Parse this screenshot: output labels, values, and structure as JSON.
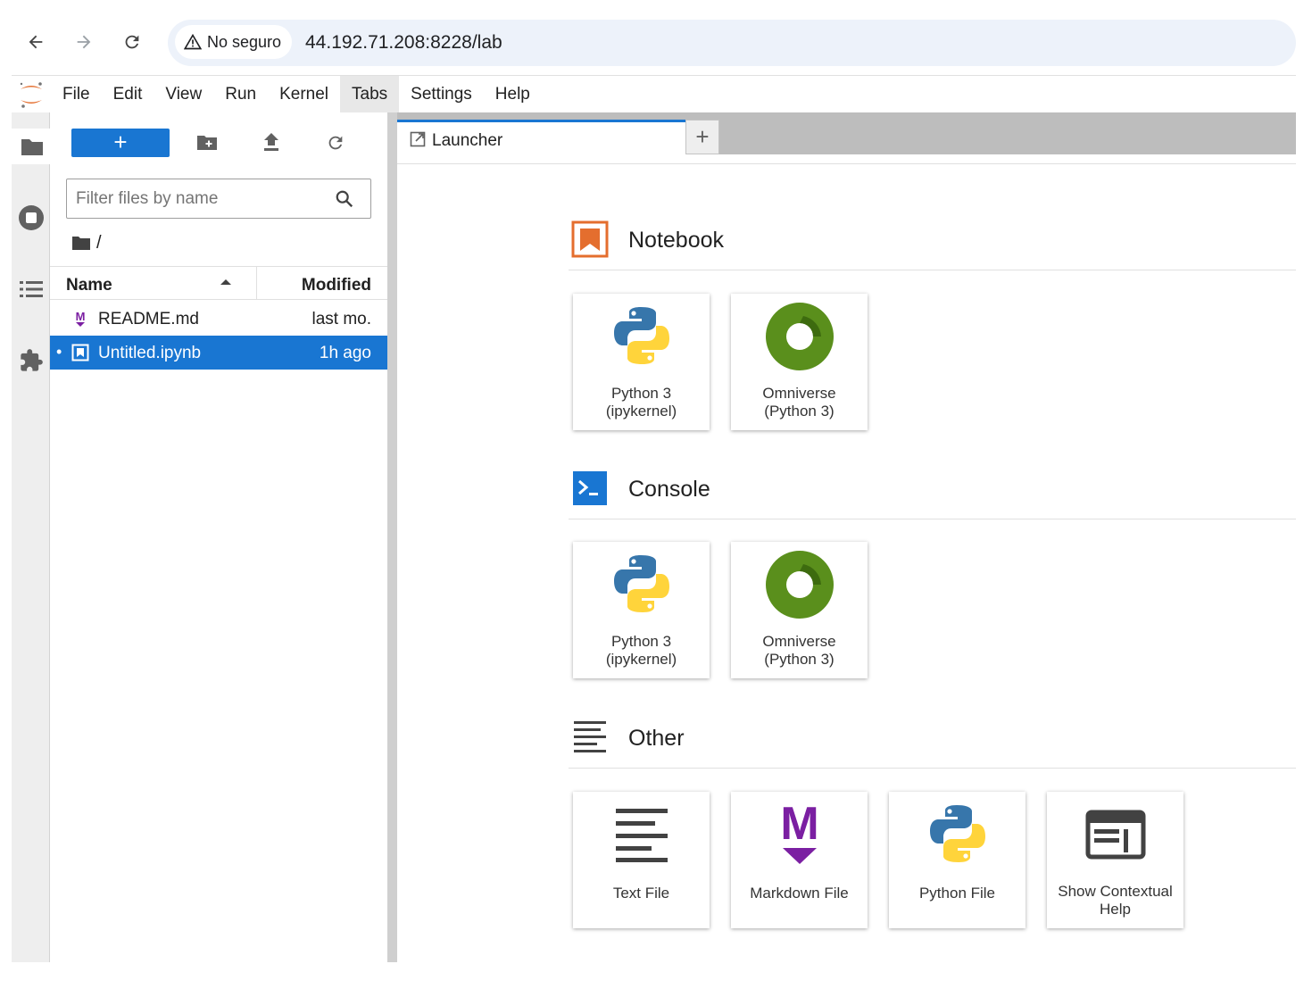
{
  "browser": {
    "security_label": "No seguro",
    "url": "44.192.71.208:8228/lab"
  },
  "menubar": {
    "items": [
      "File",
      "Edit",
      "View",
      "Run",
      "Kernel",
      "Tabs",
      "Settings",
      "Help"
    ],
    "active_item": "Tabs"
  },
  "filebrowser": {
    "new_button_label": "+",
    "filter_placeholder": "Filter files by name",
    "breadcrumb": "/",
    "columns": {
      "name": "Name",
      "modified": "Modified"
    },
    "files": [
      {
        "name": "README.md",
        "modified": "last mo.",
        "icon": "markdown-icon",
        "selected": false
      },
      {
        "name": "Untitled.ipynb",
        "modified": "1h ago",
        "icon": "notebook-icon",
        "selected": true
      }
    ]
  },
  "tabs": {
    "items": [
      {
        "label": "Launcher",
        "icon": "launcher-icon"
      }
    ],
    "add_label": "+"
  },
  "launcher": {
    "sections": [
      {
        "title": "Notebook",
        "icon": "notebook-icon",
        "cards": [
          {
            "line1": "Python 3",
            "line2": "(ipykernel)",
            "icon": "python-icon"
          },
          {
            "line1": "Omniverse",
            "line2": "(Python 3)",
            "icon": "omniverse-icon"
          }
        ]
      },
      {
        "title": "Console",
        "icon": "console-icon",
        "cards": [
          {
            "line1": "Python 3",
            "line2": "(ipykernel)",
            "icon": "python-icon"
          },
          {
            "line1": "Omniverse",
            "line2": "(Python 3)",
            "icon": "omniverse-icon"
          }
        ]
      },
      {
        "title": "Other",
        "icon": "other-icon",
        "cards": [
          {
            "line1": "Text File",
            "icon": "text-file-icon"
          },
          {
            "line1": "Markdown File",
            "icon": "markdown-icon"
          },
          {
            "line1": "Python File",
            "icon": "python-icon"
          },
          {
            "line1": "Show Contextual",
            "line2": "Help",
            "icon": "contextual-help-icon"
          }
        ]
      }
    ]
  },
  "colors": {
    "accent": "#1976d2",
    "jupyter_orange": "#e46e2e",
    "markdown_purple": "#7b1fa2",
    "omniverse_green": "#76b900"
  }
}
